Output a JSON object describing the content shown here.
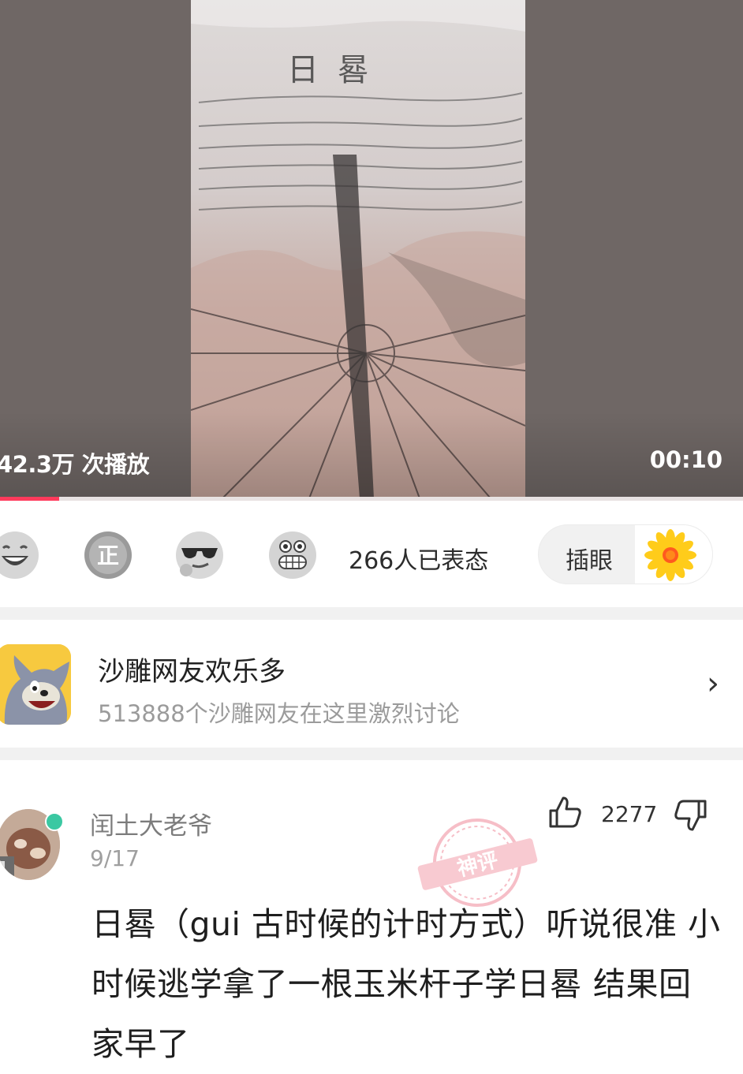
{
  "video": {
    "play_count": "42.3万 次播放",
    "duration": "00:10",
    "progress": 0.08,
    "frame_title": "日晷"
  },
  "reactions": {
    "emojis": [
      "laughing-emoji-icon",
      "zheng-badge-icon",
      "sunglasses-emoji-icon",
      "grinning-emoji-icon"
    ],
    "count_text": "266人已表态",
    "comment_pill_label": "插眼",
    "pill_icon": "sunflower-icon"
  },
  "group": {
    "name": "沙雕网友欢乐多",
    "subtitle": "513888个沙雕网友在这里激烈讨论",
    "chevron": "›"
  },
  "comment": {
    "username": "闰土大老爷",
    "date": "9/17",
    "likes": "2277",
    "stamp_label": "神评",
    "text": "日晷（gui 古时候的计时方式）听说很准 小时候逃学拿了一根玉米杆子学日晷 结果回家早了"
  },
  "colors": {
    "accent": "#ff3b5c",
    "online": "#3bc8a2",
    "separator": "#f1f1f1"
  }
}
